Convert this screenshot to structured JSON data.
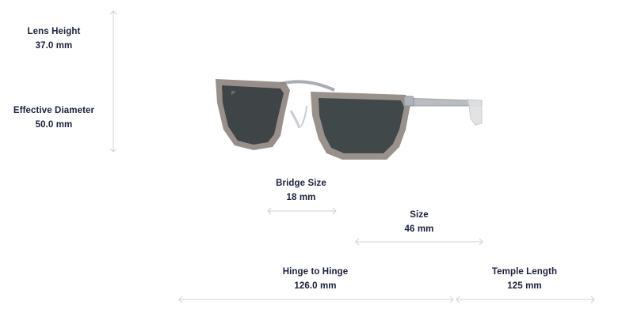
{
  "measurements": {
    "lens_height": {
      "label": "Lens Height",
      "value": "37.0 mm"
    },
    "effective_diameter": {
      "label": "Effective Diameter",
      "value": "50.0 mm"
    },
    "bridge_size": {
      "label": "Bridge Size",
      "value": "18 mm"
    },
    "size": {
      "label": "Size",
      "value": "46 mm"
    },
    "hinge_to_hinge": {
      "label": "Hinge to Hinge",
      "value": "126.0 mm"
    },
    "temple_length": {
      "label": "Temple Length",
      "value": "125 mm"
    }
  },
  "product_image": {
    "lens_badge": "P",
    "colors": {
      "frame": "#8f8680",
      "lens": "#3f4547",
      "metal": "#b9bcc0",
      "text": "#1a1f3a",
      "guide": "#cfd0d6"
    }
  }
}
